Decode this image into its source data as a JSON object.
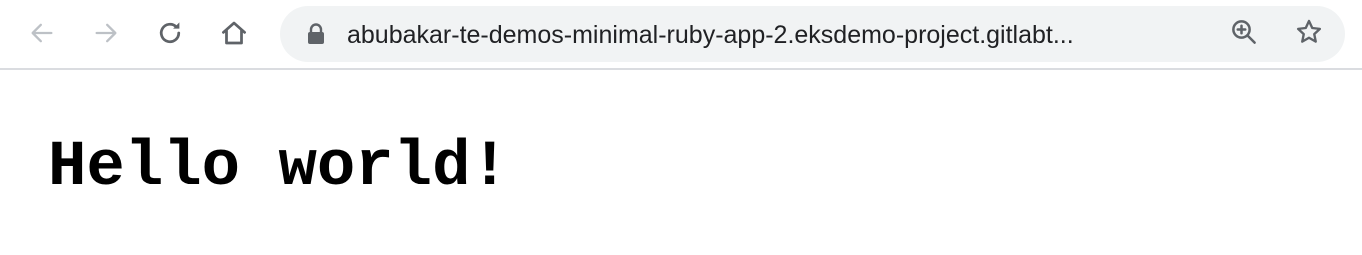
{
  "browser": {
    "nav": {
      "back": "back-arrow-icon",
      "forward": "forward-arrow-icon",
      "reload": "reload-icon",
      "home": "home-icon"
    },
    "omnibox": {
      "url": "abubakar-te-demos-minimal-ruby-app-2.eksdemo-project.gitlabt...",
      "lock": "lock-icon",
      "zoom": "zoom-in-icon",
      "bookmark": "star-icon"
    },
    "colors": {
      "toolbar_bg": "#ffffff",
      "omnibox_bg": "#f1f3f4",
      "icon_active": "#5f6368",
      "icon_disabled": "#bdc1c6",
      "divider": "#dadce0"
    }
  },
  "page": {
    "heading": "Hello world!"
  }
}
